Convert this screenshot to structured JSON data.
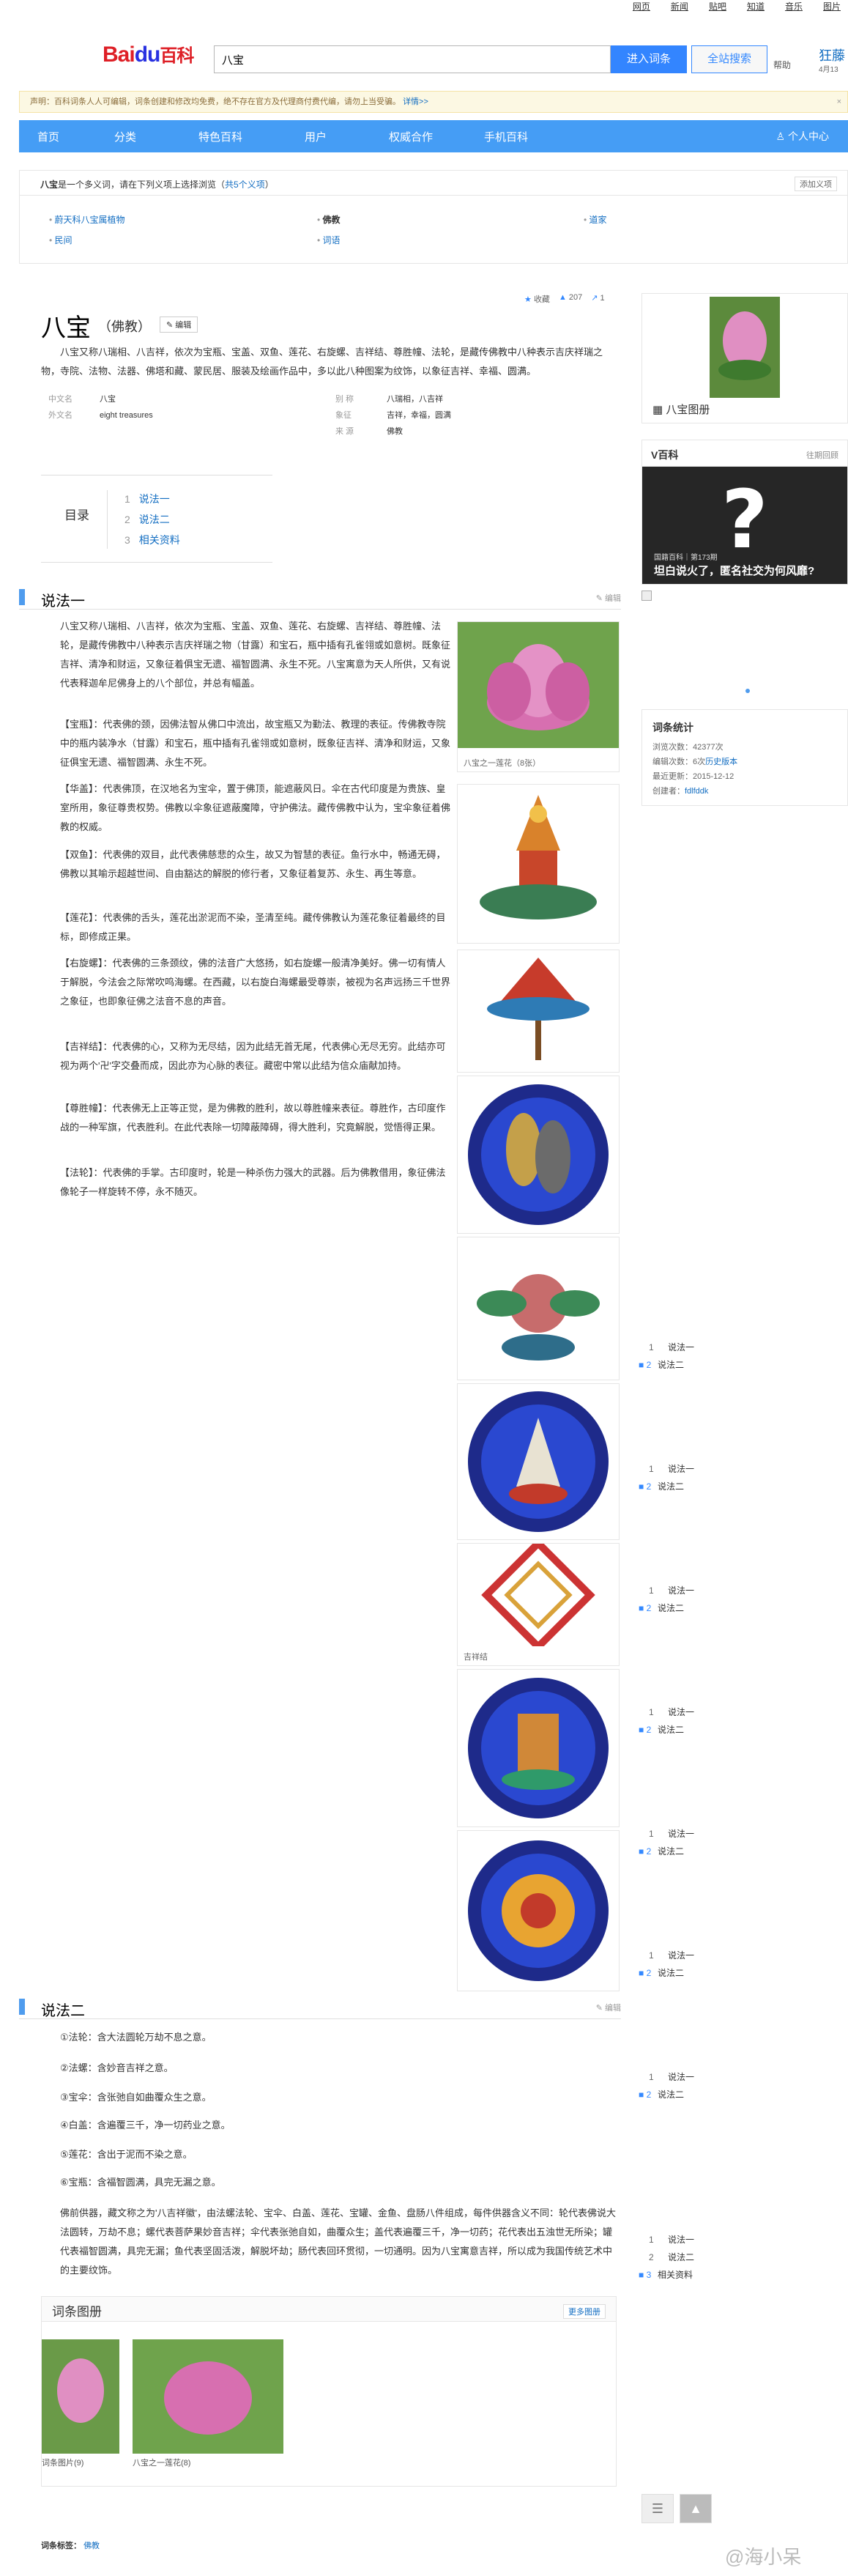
{
  "topnav": [
    "网页",
    "新闻",
    "贴吧",
    "知道",
    "音乐",
    "图片"
  ],
  "header": {
    "logo_left": "Bai",
    "logo_paw": "du",
    "logo_right": "百科",
    "search_value": "八宝",
    "enter_label": "进入词条",
    "search_label": "全站搜索",
    "help": "帮助",
    "user": "狂藤",
    "user_date": "4月13"
  },
  "notice": {
    "text": "声明：百科词条人人可编辑，词条创建和修改均免费，绝不存在官方及代理商付费代编，请勿上当受骗。",
    "link": "详情>>",
    "close": "×"
  },
  "mainnav": {
    "items": [
      "首页",
      "分类",
      "特色百科",
      "用户",
      "权威合作",
      "手机百科"
    ],
    "personal": "个人中心"
  },
  "polysemy": {
    "word": "八宝",
    "text": "是一个多义词，请在下列义项上选择浏览（",
    "count": "共5个义项",
    "text_end": "）",
    "add": "添加义项",
    "items": [
      "蔚天科八宝属植物",
      "佛教",
      "道家",
      "民间",
      "词语"
    ]
  },
  "entry": {
    "title": "八宝",
    "subtitle": "（佛教）",
    "edit": "编辑",
    "collect": "收藏",
    "likes": "207",
    "shares": "1",
    "summary": "八宝又称八瑞相、八吉祥，依次为宝瓶、宝盖、双鱼、莲花、右旋螺、吉祥结、尊胜幢、法轮，是藏传佛教中八种表示吉庆祥瑞之物，寺院、法物、法器、佛塔和藏、蒙民居、服装及绘画作品中，多以此八种图案为纹饰，以象征吉祥、幸福、圆满。",
    "info": [
      {
        "k": "中文名",
        "v": "八宝"
      },
      {
        "k": "外文名",
        "v": "eight treasures"
      },
      {
        "k": "别 称",
        "v": "八瑞相，八吉祥"
      },
      {
        "k": "象征",
        "v": "吉祥，幸福，圆满"
      },
      {
        "k": "来 源",
        "v": "佛教"
      }
    ]
  },
  "catalog": {
    "label": "目录",
    "items": [
      "说法一",
      "说法二",
      "相关资料"
    ]
  },
  "section1": {
    "title": "说法一",
    "edit": "编辑",
    "paras": [
      "八宝又称八瑞相、八吉祥，依次为宝瓶、宝盖、双鱼、莲花、右旋螺、吉祥结、尊胜幢、法轮，是藏传佛教中八种表示吉庆祥瑞之物（甘露）和宝石，瓶中插有孔雀翎或如意树。既象征吉祥、清净和财运，又象征着俱宝无遗、福智圆满、永生不死。八宝寓意为天人所供，又有说代表释迦牟尼佛身上的八个部位，并总有幅盖。",
      "【宝瓶】：代表佛的颈，因佛法智从佛口中流出，故宝瓶又为勤法、教理的表征。传佛教寺院中的瓶内装净水（甘露）和宝石，瓶中插有孔雀翎或如意树，既象征吉祥、清净和财运，又象征俱宝无遗、福智圆满、永生不死。",
      "【华盖】：代表佛顶，在汉地名为宝伞，置于佛顶，能遮蔽风日。伞在古代印度是为贵族、皇室所用，象征尊贵权势。佛教以伞象征遮蔽魔障，守护佛法。藏传佛教中认为，宝伞象征着佛教的权威。",
      "【双鱼】：代表佛的双目，此代表佛慈悲的众生，故又为智慧的表征。鱼行水中，畅通无碍，佛教以其喻示超越世间、自由豁达的解脱的修行者，又象征着复苏、永生、再生等意。",
      "【莲花】：代表佛的舌头，莲花出淤泥而不染，圣清至纯。藏传佛教认为莲花象征着最终的目标，即修成正果。",
      "【右旋螺】：代表佛的三条颈纹，佛的法音广大悠扬，如右旋螺一般清净美好。佛一切有情人于解脱，今法会之际常吹鸣海螺。在西藏，以右旋白海螺最受尊崇，被视为名声远扬三千世界之象征，也即象征佛之法音不息的声音。",
      "【吉祥结】：代表佛的心，又称为无尽结，因为此结无首无尾，代表佛心无尽无穷。此结亦可视为两个'卍'字交叠而成，因此亦为心脉的表征。藏密中常以此结为信众庙献加持。",
      "【尊胜幢】：代表佛无上正等正觉，是为佛教的胜利，故以尊胜幢来表征。尊胜作，古印度作战的一种军旗，代表胜利。在此代表除一切障蔽障碍，得大胜利，究竟解脱，觉悟得正果。",
      "【法轮】：代表佛的手掌。古印度时，轮是一种杀伤力强大的武器。后为佛教借用，象征佛法像轮子一样旋转不停，永不随灭。"
    ],
    "img_caption": "八宝之一莲花（8张）"
  },
  "section2": {
    "title": "说法二",
    "edit": "编辑",
    "items": [
      "①法轮：含大法圆轮万劫不息之意。",
      "②法螺：含妙音吉祥之意。",
      "③宝伞：含张弛自如曲覆众生之意。",
      "④白盖：含遍覆三千，净一切药业之意。",
      "⑤莲花：含出于泥而不染之意。",
      "⑥宝瓶：含福智圆满，具完无漏之意。"
    ],
    "para": "佛前供器，藏文称之为'八吉祥徽'，由法螺法轮、宝伞、白盖、莲花、宝罐、金鱼、盘肠八件组成，每件供器含义不同：轮代表佛说大法圆转，万劫不息；螺代表菩萨果妙音吉祥；伞代表张弛自如，曲覆众生；盖代表遍覆三千，净一切药；花代表出五浊世无所染；罐代表福智圆满，具完无漏；鱼代表坚固活泼，解脱坏劫；肠代表回环贯彻，一切通明。因为八宝寓意吉祥，所以成为我国传统艺术中的主要纹饰。"
  },
  "img_caption_knot": "吉祥结",
  "sidebar": {
    "album_title": "八宝图册",
    "v_title": "V百科",
    "v_past": "往期回顾",
    "v_small": "国籍百科｜第173期",
    "v_main": "坦白说火了，匿名社交为何风靡?",
    "v_q": "?",
    "stats_title": "词条统计",
    "stats": [
      {
        "k": "浏览次数：",
        "v": "42377次"
      },
      {
        "k": "编辑次数：",
        "v": "6次",
        "link": "历史版本"
      },
      {
        "k": "最近更新：",
        "v": "2015-12-12"
      },
      {
        "k": "创建者：",
        "v": "",
        "link": "fdlfddk"
      }
    ]
  },
  "toc_float": {
    "groups": [
      [
        "说法一",
        "说法二"
      ],
      [
        "说法一",
        "说法二"
      ],
      [
        "说法一",
        "说法二"
      ],
      [
        "说法一",
        "说法二"
      ],
      [
        "说法一",
        "说法二"
      ],
      [
        "说法一",
        "说法二"
      ],
      [
        "说法一",
        "说法二"
      ]
    ],
    "final": [
      "说法一",
      "说法二",
      "相关资料"
    ]
  },
  "album": {
    "title": "词条图册",
    "more": "更多图册",
    "thumbs": [
      "词条图片(9)",
      "八宝之一莲花(8)"
    ]
  },
  "tags": {
    "label": "词条标签：",
    "value": "佛教"
  },
  "watermark": "@海小呆",
  "colors": {
    "accent": "#459df5",
    "link": "#136ec2",
    "logo_red": "#de1f26",
    "logo_blue": "#2932e1"
  }
}
